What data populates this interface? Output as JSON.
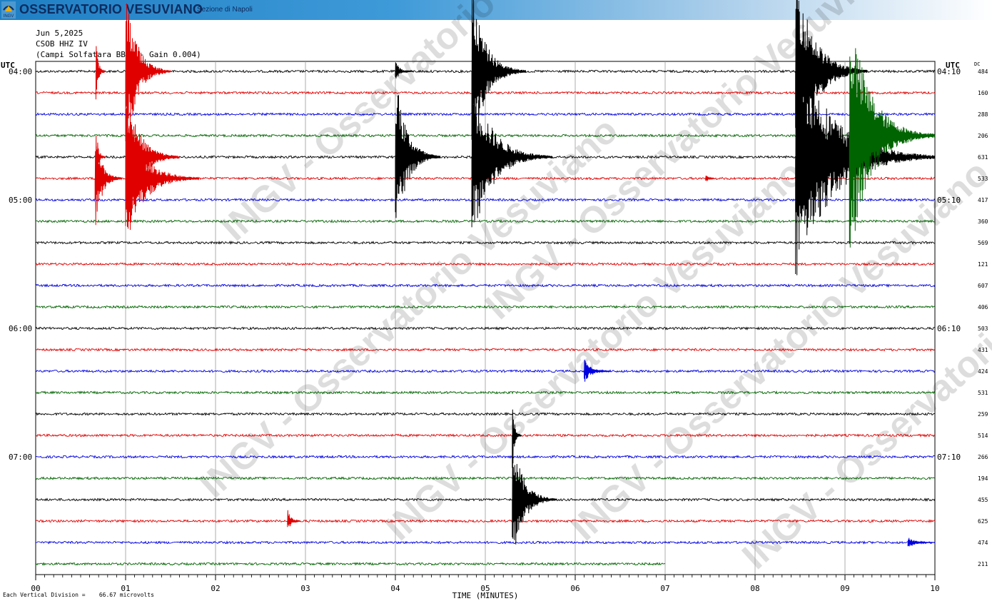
{
  "banner": {
    "title": "OSSERVATORIO VESUVIANO",
    "subtitle": "Sezione di Napoli",
    "logo_text": "INGV",
    "gradient_start": "#1f7fc4",
    "title_color": "#0d2b5e"
  },
  "header": {
    "date": "Jun 5,2025",
    "station": "CSOB HHZ IV",
    "description": "(Campi Solfatara BB)  - Gain 0.004)"
  },
  "watermark": "INGV - Osservatorio Vesuviano",
  "footer": {
    "scale_note": "Each Vertical Division =    66.67 microvolts"
  },
  "chart_data": {
    "type": "line",
    "subtype": "helicorder",
    "xlabel": "TIME (MINUTES)",
    "x_ticks": [
      "00",
      "01",
      "02",
      "03",
      "04",
      "05",
      "06",
      "07",
      "08",
      "09",
      "10"
    ],
    "xlim": [
      0,
      10
    ],
    "left_axis_title": "UTC",
    "right_axis_title": "UTC",
    "dc_header": "DC",
    "left_time_labels": [
      {
        "row": 0,
        "label": "04:00"
      },
      {
        "row": 6,
        "label": "05:00"
      },
      {
        "row": 12,
        "label": "06:00"
      },
      {
        "row": 18,
        "label": "07:00"
      }
    ],
    "right_time_labels": [
      {
        "row": 0,
        "label": "04:10"
      },
      {
        "row": 6,
        "label": "05:10"
      },
      {
        "row": 12,
        "label": "06:10"
      },
      {
        "row": 18,
        "label": "07:10"
      }
    ],
    "trace_colors": [
      "#000000",
      "#e00000",
      "#0000e0",
      "#006400"
    ],
    "dc_values": [
      484,
      160,
      288,
      206,
      631,
      533,
      417,
      360,
      569,
      121,
      607,
      406,
      503,
      431,
      424,
      531,
      259,
      514,
      266,
      194,
      455,
      625,
      474,
      211
    ],
    "last_row_end_minute": 7.0,
    "events": [
      {
        "row": 0,
        "minute": 0.67,
        "amp": 1.6,
        "dur": 0.1,
        "color_index": 1
      },
      {
        "row": 4,
        "minute": 0.67,
        "amp": 1.6,
        "dur": 0.1,
        "color_index": 1
      },
      {
        "row": 5,
        "minute": 0.66,
        "amp": 2.5,
        "dur": 0.3,
        "color_index": 1
      },
      {
        "row": 0,
        "minute": 1.0,
        "amp": 4.0,
        "dur": 0.5,
        "color_index": 1,
        "clip": true
      },
      {
        "row": 4,
        "minute": 1.0,
        "amp": 3.5,
        "dur": 0.6,
        "color_index": 1,
        "clip": true
      },
      {
        "row": 5,
        "minute": 1.02,
        "amp": 3.0,
        "dur": 0.8,
        "color_index": 1
      },
      {
        "row": 0,
        "minute": 4.0,
        "amp": 0.5,
        "dur": 0.2,
        "color_index": 0
      },
      {
        "row": 4,
        "minute": 4.0,
        "amp": 4.0,
        "dur": 0.5,
        "color_index": 0
      },
      {
        "row": 0,
        "minute": 4.85,
        "amp": 4.0,
        "dur": 0.6,
        "color_index": 0,
        "clip": true
      },
      {
        "row": 4,
        "minute": 4.85,
        "amp": 4.0,
        "dur": 0.9,
        "color_index": 0,
        "clip": true
      },
      {
        "row": 20,
        "minute": 5.3,
        "amp": 3.0,
        "dur": 0.5,
        "color_index": 0
      },
      {
        "row": 17,
        "minute": 5.3,
        "amp": 2.0,
        "dur": 0.1,
        "color_index": 0
      },
      {
        "row": 14,
        "minute": 6.1,
        "amp": 0.6,
        "dur": 0.3,
        "color_index": 2
      },
      {
        "row": 21,
        "minute": 2.8,
        "amp": 0.6,
        "dur": 0.15,
        "color_index": 1
      },
      {
        "row": 5,
        "minute": 7.45,
        "amp": 0.25,
        "dur": 0.1,
        "color_index": 1
      },
      {
        "row": 0,
        "minute": 8.45,
        "amp": 5.0,
        "dur": 0.8,
        "color_index": 0,
        "clip": true
      },
      {
        "row": 4,
        "minute": 8.45,
        "amp": 6.0,
        "dur": 1.6,
        "color_index": 0,
        "clip": true
      },
      {
        "row": 3,
        "minute": 9.05,
        "amp": 6.0,
        "dur": 1.4,
        "color_index": 3,
        "clip": true
      },
      {
        "row": 22,
        "minute": 9.7,
        "amp": 0.3,
        "dur": 0.3,
        "color_index": 2
      }
    ]
  }
}
